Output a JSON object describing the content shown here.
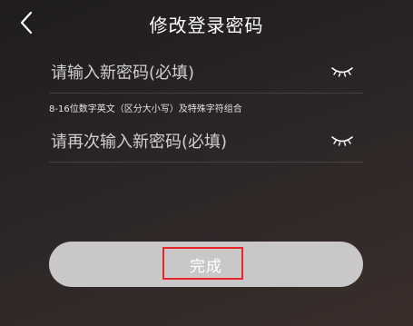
{
  "header": {
    "title": "修改登录密码",
    "back_icon": "chevron-left-icon"
  },
  "form": {
    "new_password": {
      "placeholder": "请输入新密码(必填)",
      "value": "",
      "visibility_icon": "eye-closed-icon"
    },
    "hint": "8-16位数字英文（区分大小写）及特殊字符组合",
    "confirm_password": {
      "placeholder": "请再次输入新密码(必填)",
      "value": "",
      "visibility_icon": "eye-closed-icon"
    }
  },
  "actions": {
    "done_label": "完成",
    "done_enabled": false
  },
  "colors": {
    "button_disabled": "#c9c7c8",
    "highlight": "#e6262b"
  }
}
